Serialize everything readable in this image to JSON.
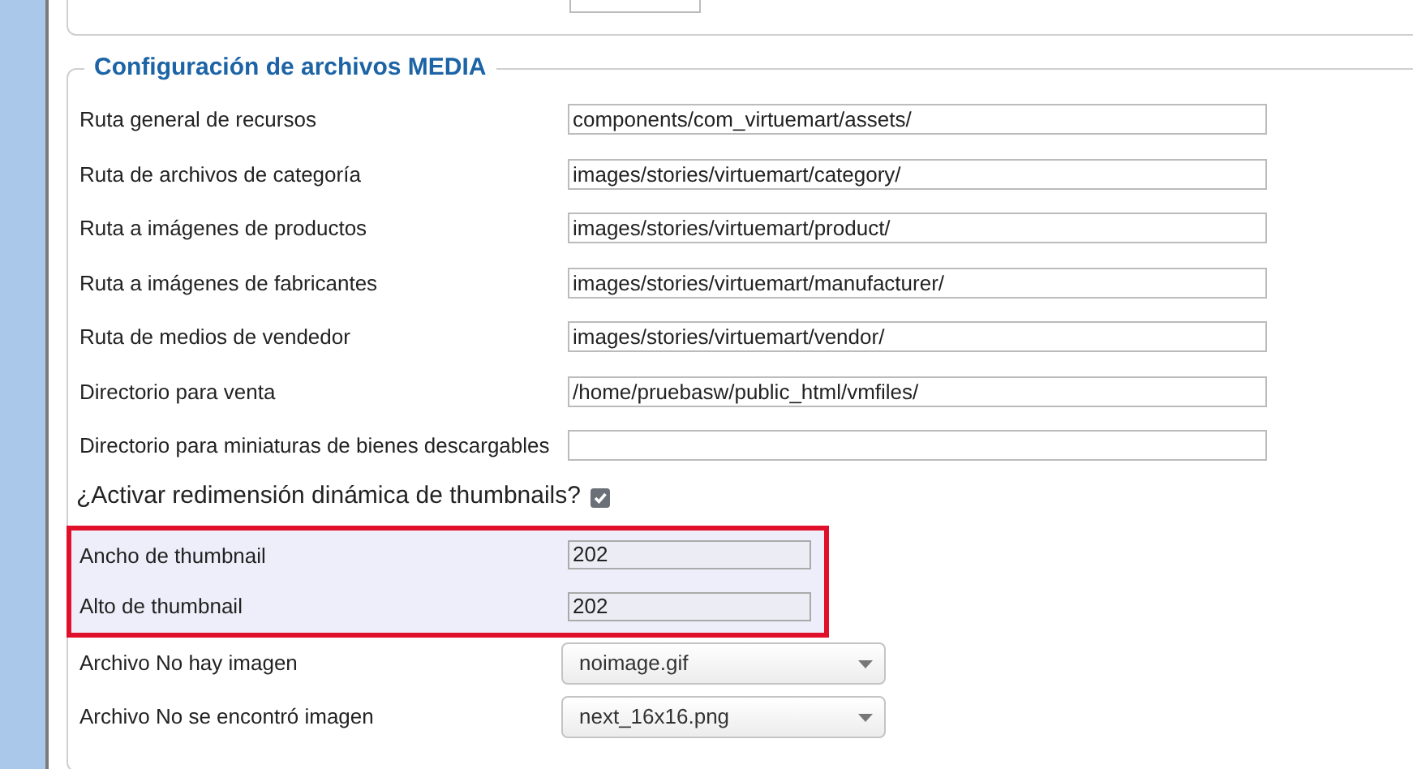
{
  "section": {
    "title": "Configuración de archivos MEDIA",
    "fields": [
      {
        "kind": "text",
        "label": "Ruta general de recursos",
        "value": "components/com_virtuemart/assets/"
      },
      {
        "kind": "text",
        "label": "Ruta de archivos de categoría",
        "value": "images/stories/virtuemart/category/"
      },
      {
        "kind": "text",
        "label": "Ruta a imágenes de productos",
        "value": "images/stories/virtuemart/product/"
      },
      {
        "kind": "text",
        "label": "Ruta a imágenes de fabricantes",
        "value": "images/stories/virtuemart/manufacturer/"
      },
      {
        "kind": "text",
        "label": "Ruta de medios de vendedor",
        "value": "images/stories/virtuemart/vendor/"
      },
      {
        "kind": "text",
        "label": "Directorio para venta",
        "value": "/home/pruebasw/public_html/vmfiles/"
      },
      {
        "kind": "text",
        "label": "Directorio para miniaturas de bienes descargables"
      },
      {
        "kind": "checkbox",
        "label": "¿Activar redimensión dinámica de thumbnails?",
        "checked": true
      }
    ],
    "highlighted_fields": [
      {
        "label": "Ancho de thumbnail",
        "value": "202"
      },
      {
        "label": "Alto de thumbnail",
        "value": "202"
      }
    ],
    "select_fields": [
      {
        "label": "Archivo No hay imagen",
        "value": "noimage.gif"
      },
      {
        "label": "Archivo No se encontró imagen",
        "value": "next_16x16.png"
      }
    ]
  }
}
